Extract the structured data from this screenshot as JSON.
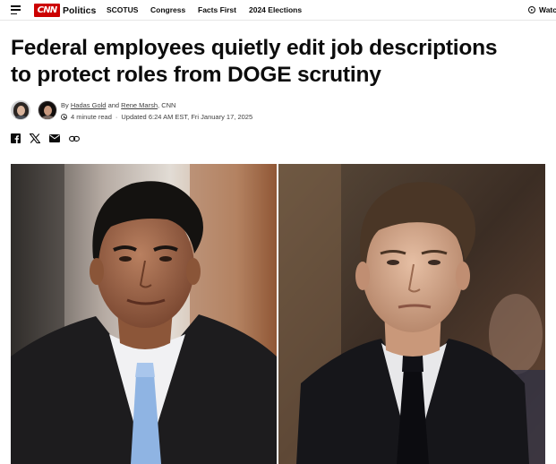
{
  "nav": {
    "section": "Politics",
    "links": [
      "SCOTUS",
      "Congress",
      "Facts First",
      "2024 Elections"
    ],
    "watch_label": "Watch"
  },
  "brand": {
    "logo_text": "CNN",
    "color": "#cc0000"
  },
  "article": {
    "headline_line1": "Federal employees quietly edit job descriptions",
    "headline_line2": "to protect roles from DOGE scrutiny",
    "byline_prefix": "By",
    "author1": "Hadas Gold",
    "and": "and",
    "author2": "Rene Marsh",
    "outlet": ", CNN",
    "read_time": "4 minute read",
    "updated": "Updated 6:24 AM EST, Fri January 17, 2025"
  },
  "share_icons": [
    "facebook-icon",
    "x-icon",
    "email-icon",
    "link-icon"
  ],
  "images": [
    "left-portrait",
    "right-portrait"
  ]
}
